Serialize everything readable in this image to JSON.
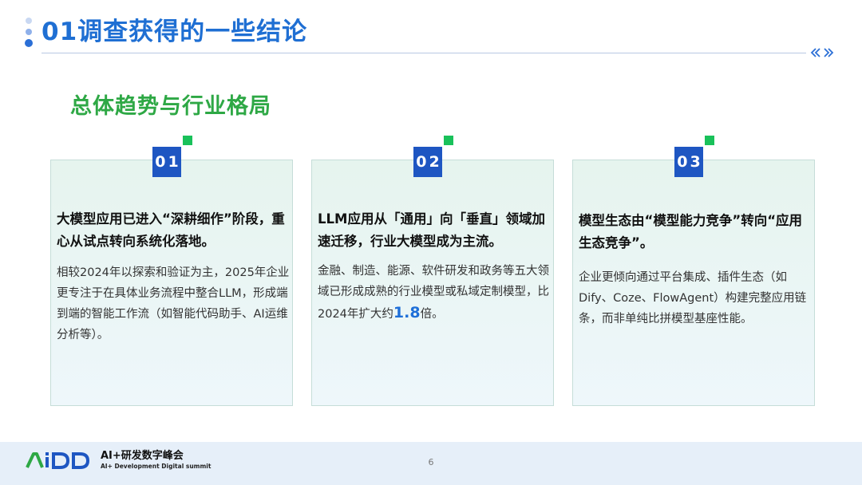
{
  "header": {
    "title": "01调查获得的一些结论",
    "accent_color": "#1f6fd3"
  },
  "subtitle": "总体趋势与行业格局",
  "cards": [
    {
      "badge": "01",
      "heading": "大模型应用已进入“深耕细作”阶段，重心从试点转向系统化落地。",
      "body": "相较2024年以探索和验证为主，2025年企业更专注于在具体业务流程中整合LLM，形成端到端的智能工作流（如智能代码助手、AI运维分析等）。"
    },
    {
      "badge": "02",
      "heading": "LLM应用从「通用」向「垂直」领域加速迁移，行业大模型成为主流。",
      "body_before": "金融、制造、能源、软件研发和政务等五大领域已形成成熟的行业模型或私域定制模型，比2024年扩大约",
      "body_highlight": "1.8",
      "body_after": "倍。"
    },
    {
      "badge": "03",
      "heading": "模型生态由“模型能力竞争”转向“应用生态竞争”。",
      "body": "企业更倾向通过平台集成、插件生态（如Dify、Coze、FlowAgent）构建完整应用链条，而非单纯比拼模型基座性能。"
    }
  ],
  "footer": {
    "logo_main": "AI+研发数字峰会",
    "logo_sub": "AI+ Development Digital summit",
    "page_number": "6"
  }
}
